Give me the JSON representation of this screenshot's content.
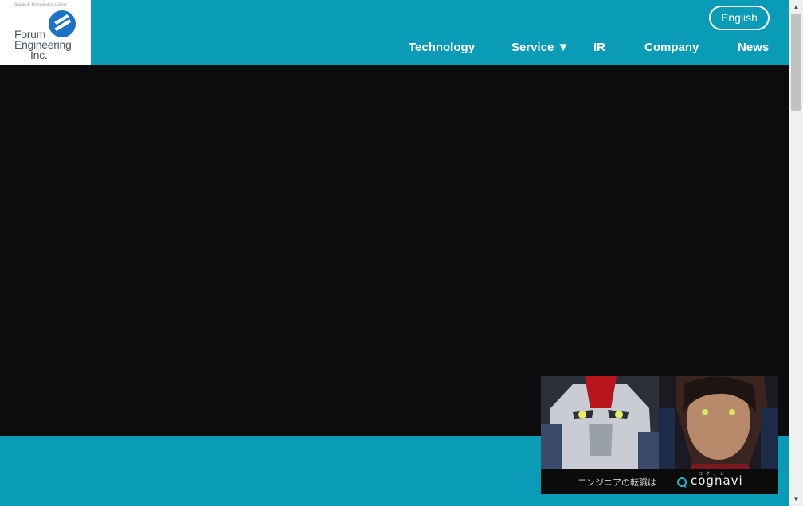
{
  "header": {
    "logo": {
      "tagline": "Human & Technological Gallery",
      "name_line1": "Forum",
      "name_line2": "Engineering",
      "name_line3": "Inc."
    },
    "language_button": "English",
    "nav": [
      {
        "label": "Technology"
      },
      {
        "label": "Service ▼"
      },
      {
        "label": "IR"
      },
      {
        "label": "Company"
      },
      {
        "label": "News"
      }
    ]
  },
  "ad": {
    "caption": "エンジニアの転職は",
    "brand": "cognavi",
    "brand_ruby": "コグナビ"
  },
  "colors": {
    "accent": "#0a9bb7",
    "hero_bg": "#0c0b0e",
    "logo_blue": "#1a73c6"
  }
}
